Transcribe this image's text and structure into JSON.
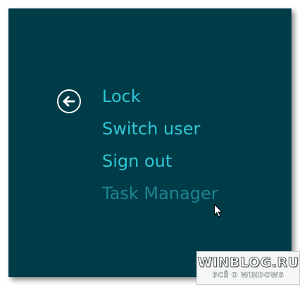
{
  "menu": {
    "items": [
      {
        "label": "Lock",
        "enabled": true
      },
      {
        "label": "Switch user",
        "enabled": true
      },
      {
        "label": "Sign out",
        "enabled": true
      },
      {
        "label": "Task Manager",
        "enabled": false
      }
    ]
  },
  "watermark": {
    "title": "WINBLOG.RU",
    "subtitle": "ВСЁ О WINDOWS"
  },
  "colors": {
    "panel_background": "#003b48",
    "menu_text": "#2fc7d4",
    "menu_text_disabled": "#1c8591",
    "back_icon": "#ffffff"
  },
  "icons": {
    "back": "back-arrow-circle-icon",
    "cursor": "mouse-pointer-icon"
  }
}
